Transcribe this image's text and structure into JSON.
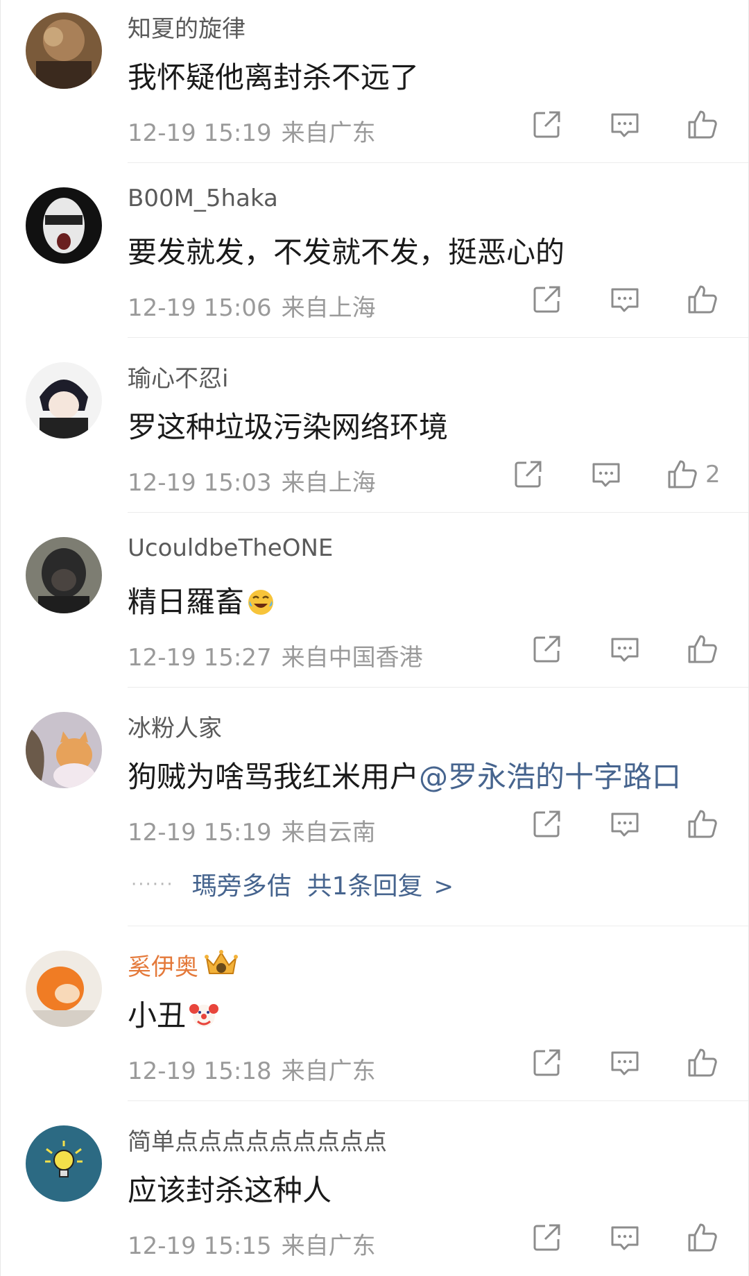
{
  "comments": [
    {
      "user": "知夏的旋律",
      "text": "我怀疑他离封杀不远了",
      "time": "12-19 15:19",
      "location": "来自广东",
      "likes": ""
    },
    {
      "user": "B00M_5haka",
      "text": "要发就发，不发就不发，挺恶心的",
      "time": "12-19 15:06",
      "location": "来自上海",
      "likes": ""
    },
    {
      "user": "瑜心不忍i",
      "text": "罗这种垃圾污染网络环境",
      "time": "12-19 15:03",
      "location": "来自上海",
      "likes": "2"
    },
    {
      "user": "UcouldbeTheONE",
      "text": "精日羅畜",
      "emoji": "tears-of-joy-emoji",
      "time": "12-19 15:27",
      "location": "来自中国香港",
      "likes": ""
    },
    {
      "user": "冰粉人家",
      "text": "狗贼为啥骂我红米用户",
      "mention": "@罗永浩的十字路口",
      "time": "12-19 15:19",
      "location": "来自云南",
      "likes": "",
      "reply_user": "瑪旁多佶",
      "reply_count": "共1条回复",
      "reply_chevron": ">"
    },
    {
      "user": "奚伊奥",
      "vip": true,
      "text": "小丑",
      "emoji": "clown-emoji",
      "time": "12-19 15:18",
      "location": "来自广东",
      "likes": ""
    },
    {
      "user": "简单点点点点点点点点点",
      "text": "应该封杀这种人",
      "time": "12-19 15:15",
      "location": "来自广东",
      "likes": ""
    }
  ],
  "colors": {
    "username": "#5a5a5a",
    "vip_username": "#e4793a",
    "mention": "#46648e",
    "meta": "#9a9a9a",
    "icon": "#8c8c8c"
  },
  "icons": [
    "share-icon",
    "comment-icon",
    "like-icon",
    "vip-crown-icon"
  ]
}
